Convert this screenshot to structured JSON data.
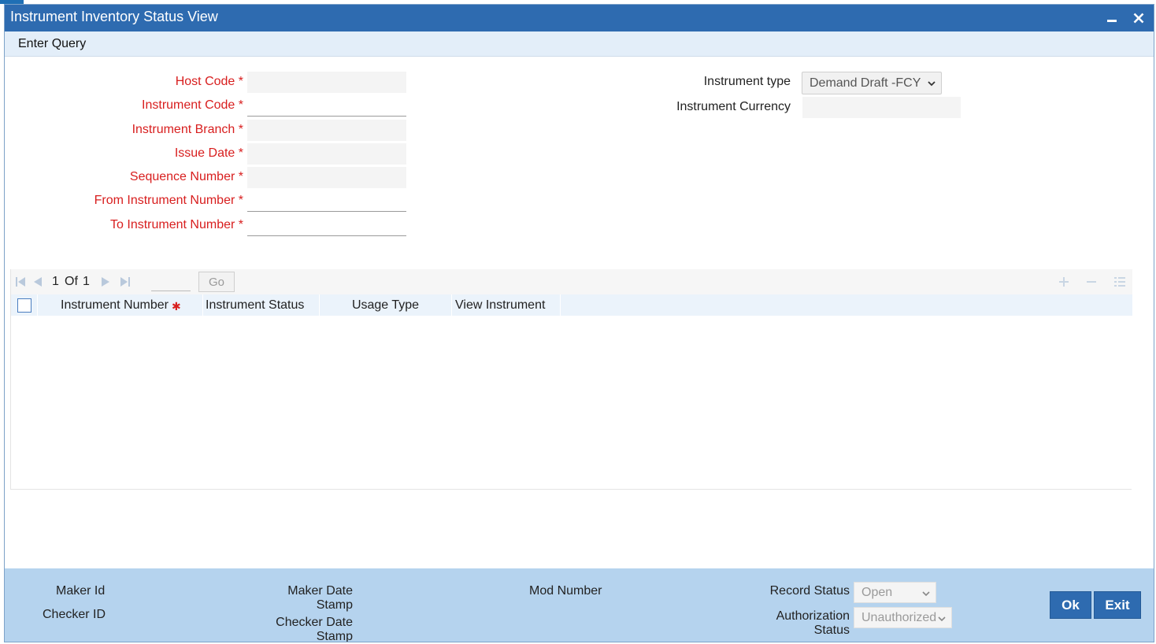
{
  "window": {
    "title": "Instrument Inventory Status View"
  },
  "menu": {
    "enter_query": "Enter Query"
  },
  "form": {
    "host_code_label": "Host Code",
    "instrument_code_label": "Instrument Code",
    "instrument_branch_label": "Instrument Branch",
    "issue_date_label": "Issue Date",
    "sequence_number_label": "Sequence Number",
    "from_instrument_number_label": "From Instrument Number",
    "to_instrument_number_label": "To Instrument Number",
    "required_mark": "*",
    "instrument_type_label": "Instrument type",
    "instrument_type_value": "Demand Draft -FCY",
    "instrument_currency_label": "Instrument Currency"
  },
  "grid": {
    "pager": {
      "current_page": "1",
      "of_label": "Of",
      "total_pages": "1",
      "go_label": "Go"
    },
    "columns": [
      "Instrument Number",
      "Instrument Status",
      "Usage Type",
      "View Instrument"
    ],
    "rows": []
  },
  "footer": {
    "maker_id_label": "Maker Id",
    "checker_id_label": "Checker ID",
    "maker_date_stamp_label_1": "Maker Date",
    "maker_date_stamp_label_2": "Stamp",
    "checker_date_stamp_label_1": "Checker Date",
    "checker_date_stamp_label_2": "Stamp",
    "mod_number_label": "Mod Number",
    "record_status_label": "Record Status",
    "record_status_value": "Open",
    "authorization_status_label_1": "Authorization",
    "authorization_status_label_2": "Status",
    "authorization_status_value": "Unauthorized",
    "ok_label": "Ok",
    "exit_label": "Exit"
  },
  "colors": {
    "titlebar": "#2e6bb0",
    "menubar": "#e3eef9",
    "required_label": "#d81e1e",
    "footer": "#b5d3ee",
    "button": "#2e6bb0"
  },
  "icons": {
    "minimize": "minimize-icon",
    "close": "close-icon",
    "first": "first-page-icon",
    "prev": "prev-page-icon",
    "next": "next-page-icon",
    "last": "last-page-icon",
    "add_row": "plus-icon",
    "delete_row": "minus-icon",
    "single_view": "list-view-icon",
    "dropdown": "chevron-down-icon"
  }
}
